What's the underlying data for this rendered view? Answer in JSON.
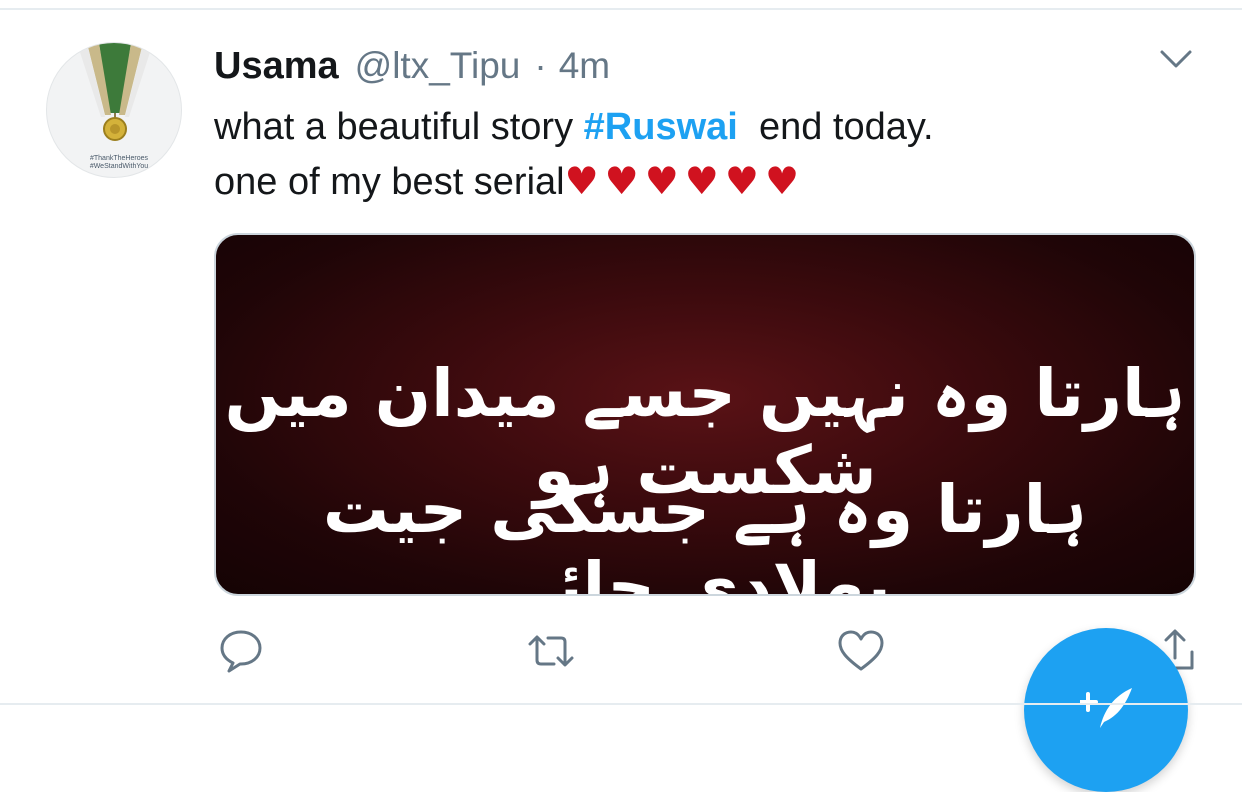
{
  "tweet": {
    "name": "Usama",
    "handle": "@ltx_Tipu",
    "separator": "·",
    "time": "4m",
    "text_part1": "what a beautiful story ",
    "hashtag": "#Ruswai",
    "text_part2": "  end today.",
    "text_line2": "one of my best serial",
    "hearts": "♥♥♥♥♥♥"
  },
  "avatar": {
    "caption_line1": "#ThankTheHeroes",
    "caption_line2": "#WeStandWithYou"
  },
  "media": {
    "urdu_line1": "ہارتا وہ نہیں جسے میدان میں شکست ہو",
    "urdu_line2": "ہارتا وہ ہے جسکی جیت بھلادی جائے"
  },
  "icons": {
    "reply": "reply-icon",
    "retweet": "retweet-icon",
    "like": "heart-icon",
    "share": "share-icon",
    "more": "chevron-down-icon",
    "compose": "compose-tweet-icon"
  },
  "colors": {
    "accent": "#1da1f2",
    "text": "#14171a",
    "secondary": "#657786",
    "heart": "#d0121f"
  }
}
